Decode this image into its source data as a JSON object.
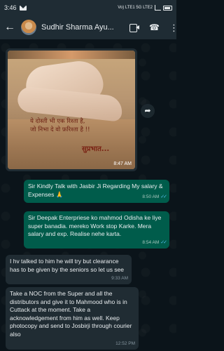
{
  "status_bar": {
    "time": "3:46",
    "indicators": "Vo) LTE1 5G LTE2"
  },
  "header": {
    "contact_name": "Sudhir Sharma Ayu...",
    "back_icon": "arrow-left-icon",
    "video_icon": "video-call-icon",
    "call_icon": "phone-call-icon",
    "more_icon": "more-vertical-icon"
  },
  "messages": [
    {
      "type": "image",
      "direction": "incoming",
      "image_text_lines": [
        "ये दोस्ती भी एक रिश्ता है,",
        "जो निभा दे वो फ़रिश्ता है !!",
        "सुप्रभात..."
      ],
      "time": "8:47 AM"
    },
    {
      "type": "text",
      "direction": "outgoing",
      "text": "Sir Kindly Talk with Jasbir Ji Regarding My  salary & Expenses 🙏",
      "time": "8:50 AM",
      "read": true
    },
    {
      "type": "text",
      "direction": "outgoing",
      "text": "Sir Deepak Enterpriese ko mahmod Odisha ke liye super banadia. mereko Work stop Karke. Mera salary  and exp. Realise nehe karta.",
      "time": "8:54 AM",
      "read": true
    },
    {
      "type": "text",
      "direction": "incoming",
      "text": "I hv talked to him he will try but clearance has to be given by the seniors so let us see",
      "time": "9:33 AM"
    },
    {
      "type": "text",
      "direction": "incoming",
      "text": "Take a NOC from the Super and all the distributors and give it to Mahmood who is in Cuttack at the moment. Take a acknowledgement from him as well. Keep photocopy and send to Josbirji through courier also",
      "time": "12:52 PM"
    }
  ],
  "colors": {
    "header_bg": "#1f2c34",
    "chat_bg": "#0b141a",
    "outgoing_bubble": "#005c4b",
    "incoming_bubble": "#202c33",
    "read_tick": "#53bdeb"
  }
}
